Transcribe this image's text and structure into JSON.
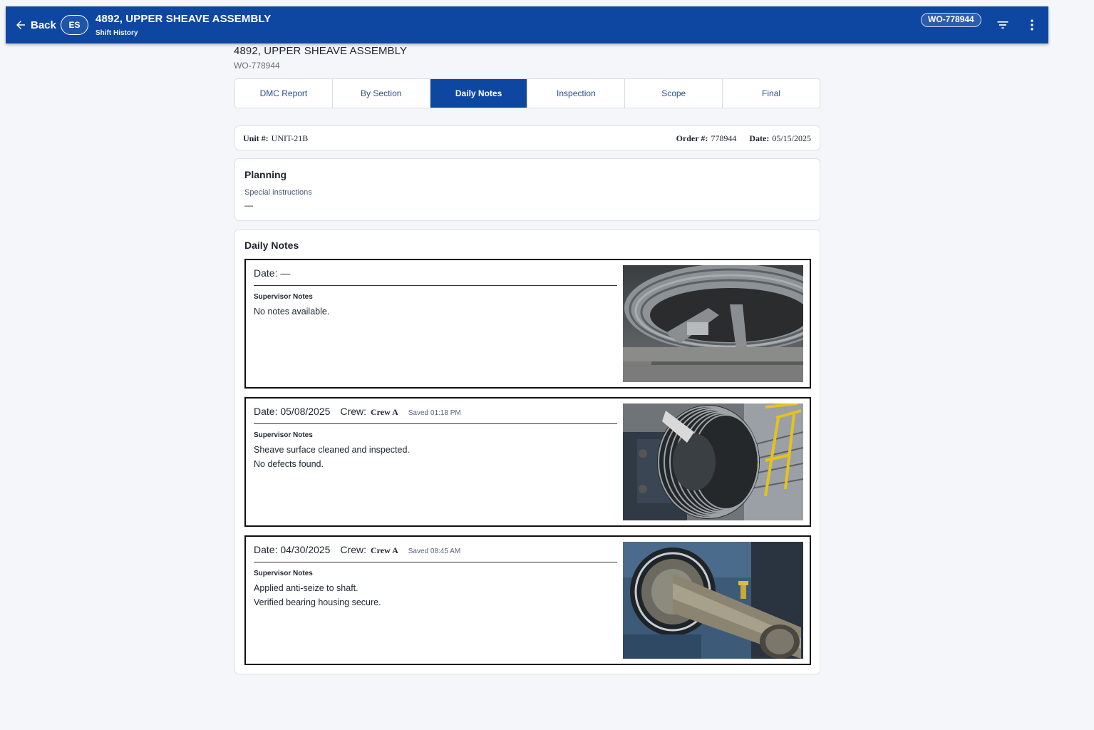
{
  "appbar": {
    "back_label": "Back",
    "avatar_initials": "ES",
    "title": "4892, UPPER SHEAVE ASSEMBLY",
    "subtitle": "Shift History",
    "wo_chip": "WO-778944",
    "icons": [
      "arrow-left-icon",
      "filter-icon",
      "more-vertical-icon"
    ]
  },
  "page": {
    "title": "4892, UPPER SHEAVE ASSEMBLY",
    "subtitle": "WO-778944"
  },
  "tabs": [
    {
      "label": "DMC Report",
      "active": false
    },
    {
      "label": "By Section",
      "active": false
    },
    {
      "label": "Daily Notes",
      "active": true
    },
    {
      "label": "Inspection",
      "active": false
    },
    {
      "label": "Scope",
      "active": false
    },
    {
      "label": "Final",
      "active": false
    }
  ],
  "info": {
    "unit_label": "Unit #:",
    "unit_value": "UNIT-21B",
    "order_label": "Order #:",
    "order_value": "778944",
    "date_label": "Date:",
    "date_value": "05/15/2025"
  },
  "planning": {
    "heading": "Planning",
    "special_label": "Special instructions",
    "special_value": "—"
  },
  "daily_notes": {
    "heading": "Daily Notes",
    "entries": [
      {
        "date": "Date: —",
        "crew_label": "",
        "crew": "",
        "saved": "",
        "notes_label": "Supervisor Notes",
        "notes": "No notes available.",
        "photo": "sheave-wheel-photo"
      },
      {
        "date": "Date: 05/08/2025",
        "crew_label": "Crew:",
        "crew": "Crew A",
        "saved": "Saved 01:18 PM",
        "notes_label": "Supervisor Notes",
        "notes": "Sheave surface cleaned and inspected.\nNo defects found.",
        "photo": "grooved-sheave-photo"
      },
      {
        "date": "Date: 04/30/2025",
        "crew_label": "Crew:",
        "crew": "Crew A",
        "saved": "Saved 08:45 AM",
        "notes_label": "Supervisor Notes",
        "notes": "Applied anti-seize to shaft.\nVerified bearing housing secure.",
        "photo": "bearing-shaft-photo"
      }
    ]
  },
  "colors": {
    "primary": "#0d47a1",
    "background": "#f4f6f9",
    "tab_text": "#2a4e86"
  }
}
